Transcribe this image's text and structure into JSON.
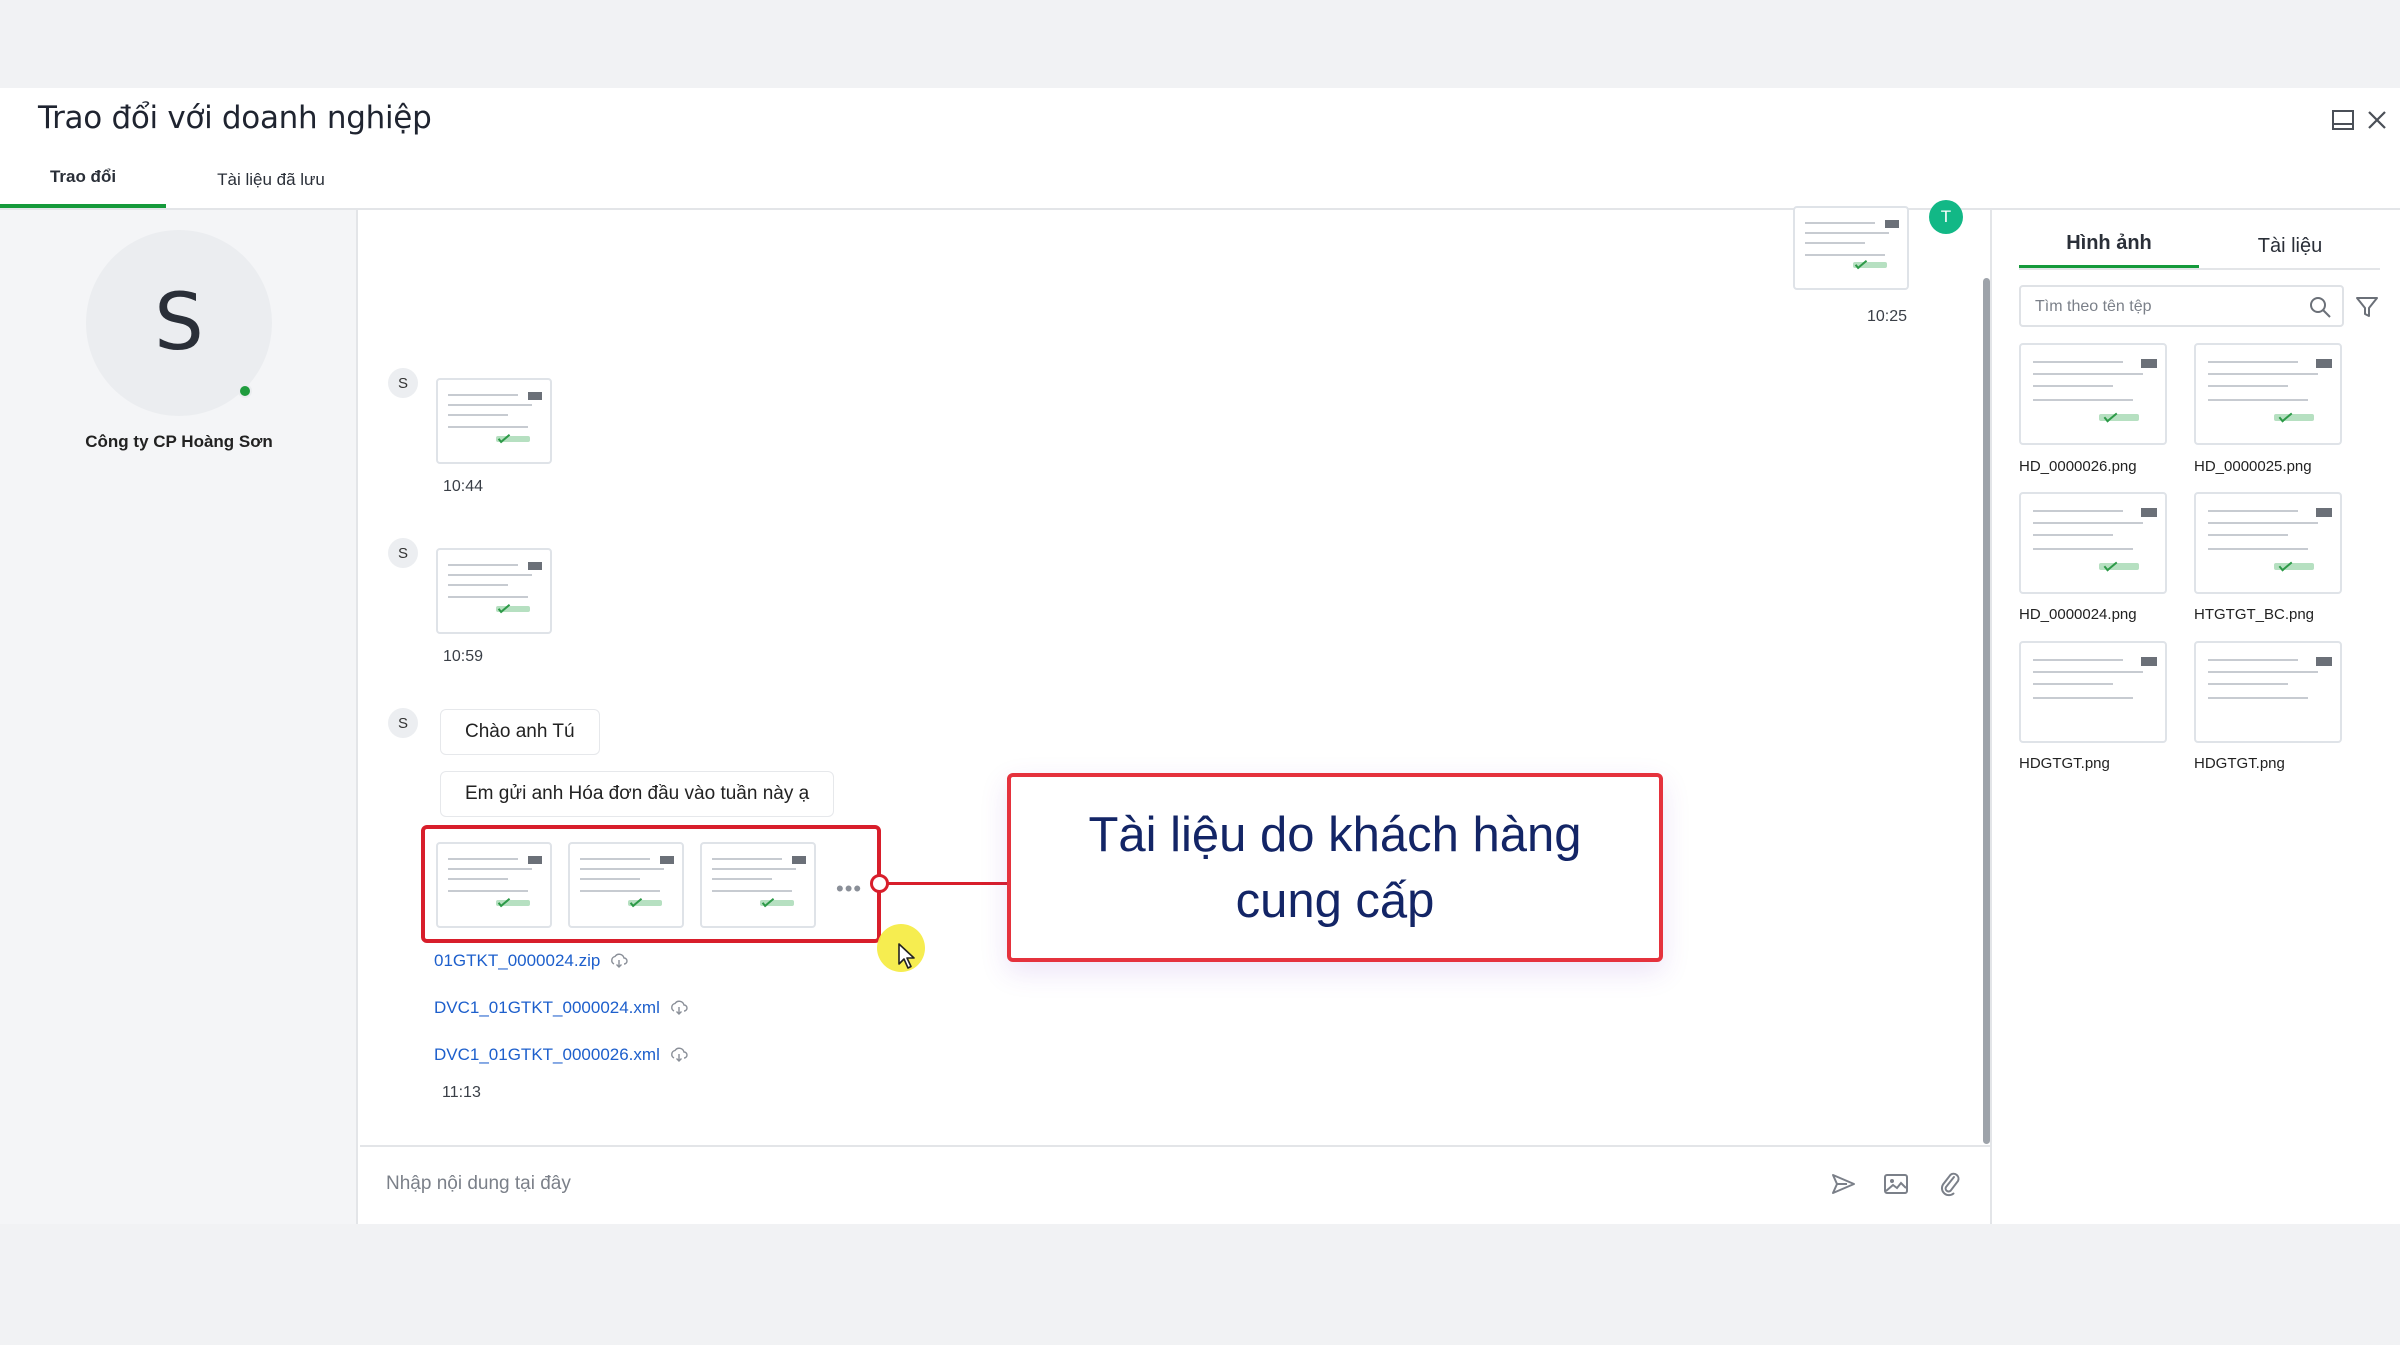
{
  "window": {
    "title": "Trao đổi với doanh nghiệp",
    "minimize_icon": "minimize-icon",
    "close_icon": "close-icon"
  },
  "tabs": [
    {
      "label": "Trao đổi",
      "active": true
    },
    {
      "label": "Tài liệu đã lưu",
      "active": false
    }
  ],
  "contact": {
    "initial": "S",
    "name": "Công ty CP Hoàng Sơn",
    "online": true
  },
  "messages": {
    "top_time": "10:25",
    "top_badge": "T",
    "m1": {
      "avatar": "S",
      "time": "10:44"
    },
    "m2": {
      "avatar": "S",
      "time": "10:59"
    },
    "m3": {
      "avatar": "S",
      "text1": "Chào anh Tú",
      "text2": "Em gửi anh Hóa đơn đầu vào tuần này ạ",
      "more": "•••",
      "files": [
        {
          "name": "01GTKT_0000024.zip"
        },
        {
          "name": "DVC1_01GTKT_0000024.xml"
        },
        {
          "name": "DVC1_01GTKT_0000026.xml"
        }
      ],
      "time": "11:13"
    }
  },
  "callout": {
    "text": "Tài liệu do khách hàng cung cấp",
    "accent": "#d81e2b"
  },
  "composer": {
    "placeholder": "Nhập nội dung tại đây",
    "icons": [
      "send-icon",
      "image-icon",
      "attach-icon"
    ]
  },
  "sidebar": {
    "tabs": [
      {
        "label": "Hình ảnh",
        "active": true
      },
      {
        "label": "Tài liệu",
        "active": false
      }
    ],
    "search_placeholder": "Tìm theo tên tệp",
    "files": [
      {
        "name": "HD_0000026.png"
      },
      {
        "name": "HD_0000025.png"
      },
      {
        "name": "HD_0000024.png"
      },
      {
        "name": "HTGTGT_BC.png"
      },
      {
        "name": "HDGTGT.png"
      },
      {
        "name": "HDGTGT.png"
      }
    ]
  },
  "colors": {
    "brand_green": "#159a3b",
    "link_blue": "#1d5fcc",
    "callout_text": "#132566"
  }
}
